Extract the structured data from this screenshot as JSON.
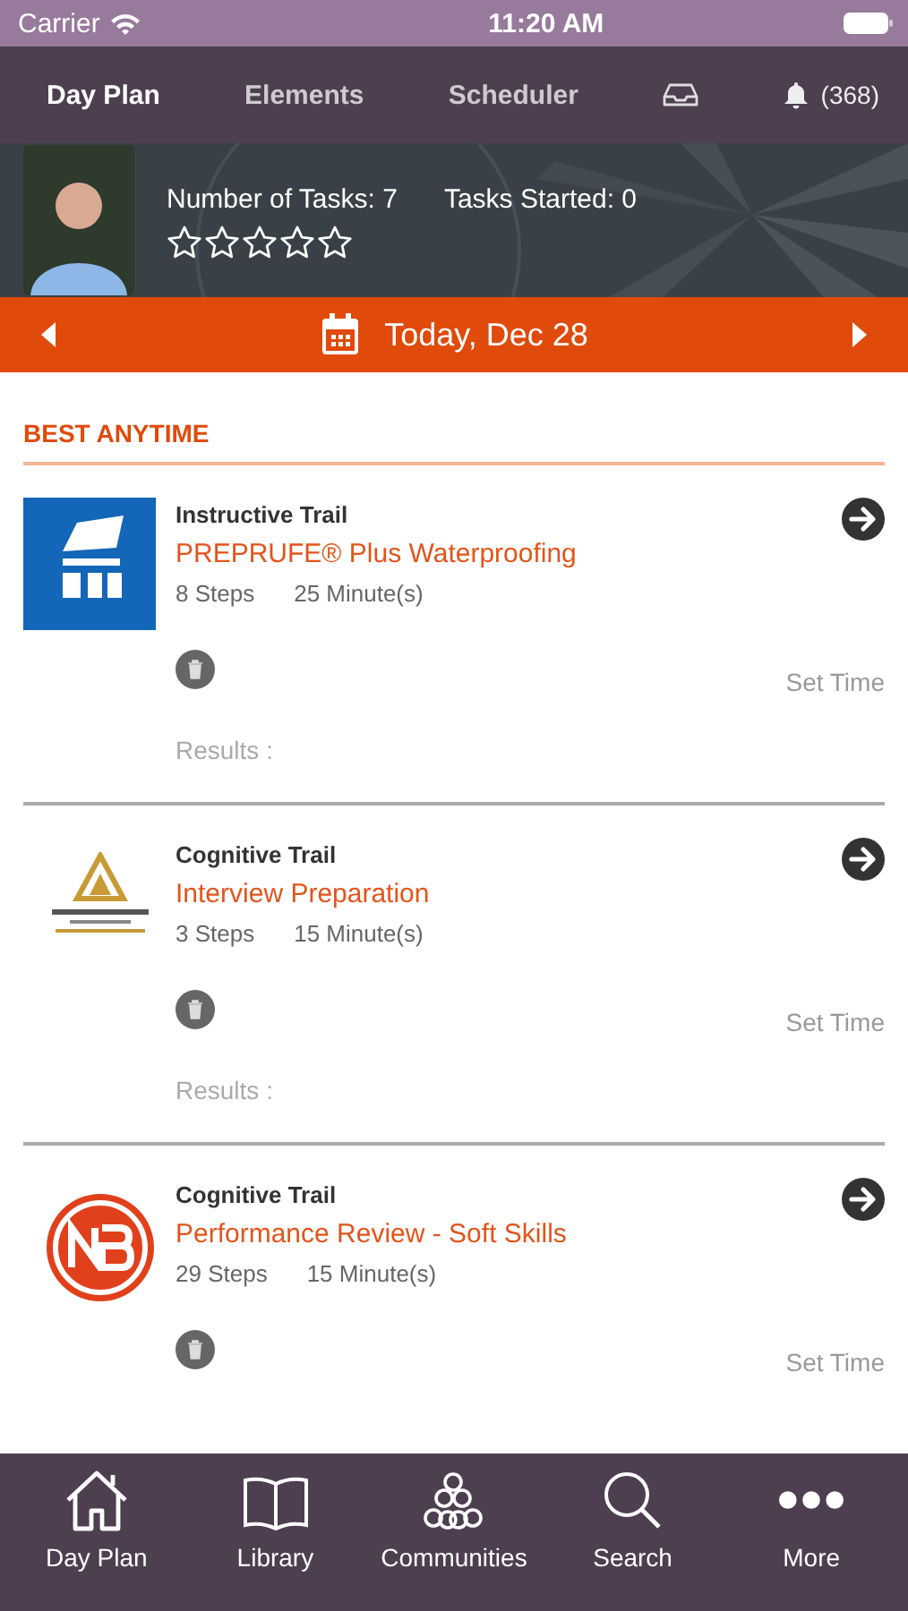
{
  "status_bar": {
    "carrier": "Carrier",
    "time": "11:20 AM"
  },
  "nav_tabs": [
    {
      "label": "Day Plan",
      "selected": true
    },
    {
      "label": "Elements",
      "selected": false
    },
    {
      "label": "Scheduler",
      "selected": false
    }
  ],
  "notifications": {
    "count": "(368)"
  },
  "profile": {
    "tasks": "Number of Tasks: 7",
    "started": "Tasks Started: 0",
    "stars": 0
  },
  "date_bar": {
    "label": "Today, Dec 28"
  },
  "section": {
    "title": "BEST ANYTIME"
  },
  "items": [
    {
      "kind": "tile",
      "type": "Instructive Trail",
      "title": "PREPRUFE® Plus Waterproofing",
      "steps": "8 Steps",
      "duration": "25 Minute(s)",
      "action": "Set Time",
      "results": "Results :"
    },
    {
      "kind": "triangle",
      "type": "Cognitive Trail",
      "title": "Interview Preparation",
      "steps": "3 Steps",
      "duration": "15 Minute(s)",
      "action": "Set Time",
      "results": "Results :"
    },
    {
      "kind": "ring",
      "type": "Cognitive Trail",
      "title": "Performance Review - Soft Skills",
      "steps": "29 Steps",
      "duration": "15 Minute(s)",
      "action": "Set Time"
    }
  ],
  "tab_bar": [
    {
      "kind": "home",
      "label": "Day Plan"
    },
    {
      "kind": "book",
      "label": "Library"
    },
    {
      "kind": "circles",
      "label": "Communities"
    },
    {
      "kind": "search",
      "label": "Search"
    },
    {
      "kind": "dots",
      "label": "More"
    }
  ]
}
